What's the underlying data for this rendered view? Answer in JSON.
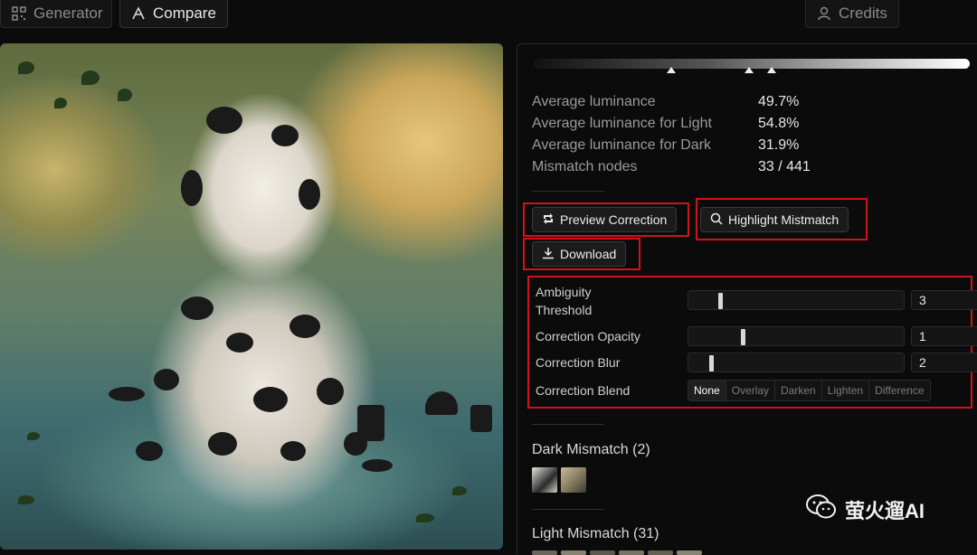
{
  "tabs": {
    "generator": "Generator",
    "compare": "Compare",
    "credits": "Credits"
  },
  "stats": [
    {
      "label": "Average luminance",
      "value": "49.7%"
    },
    {
      "label": "Average luminance for Light",
      "value": "54.8%"
    },
    {
      "label": "Average luminance for Dark",
      "value": "31.9%"
    },
    {
      "label": "Mismatch nodes",
      "value": "33 / 441"
    }
  ],
  "actions": {
    "preview": "Preview Correction",
    "highlight": "Highlight Mistmatch",
    "download": "Download"
  },
  "controls": {
    "ambiguity_label_1": "Ambiguity",
    "ambiguity_label_2": "Threshold",
    "ambiguity_value": "3",
    "opacity_label": "Correction Opacity",
    "opacity_value": "1",
    "blur_label": "Correction Blur",
    "blur_value": "2",
    "blend_label": "Correction Blend",
    "blend_options": [
      "None",
      "Overlay",
      "Darken",
      "Lighten",
      "Difference"
    ],
    "blend_selected": "None"
  },
  "sections": {
    "dark": "Dark Mismatch (2)",
    "light": "Light Mismatch (31)"
  },
  "watermark": "萤火遛AI",
  "colors": {
    "highlight_box": "#d0121b",
    "background": "#0b0b0b"
  }
}
